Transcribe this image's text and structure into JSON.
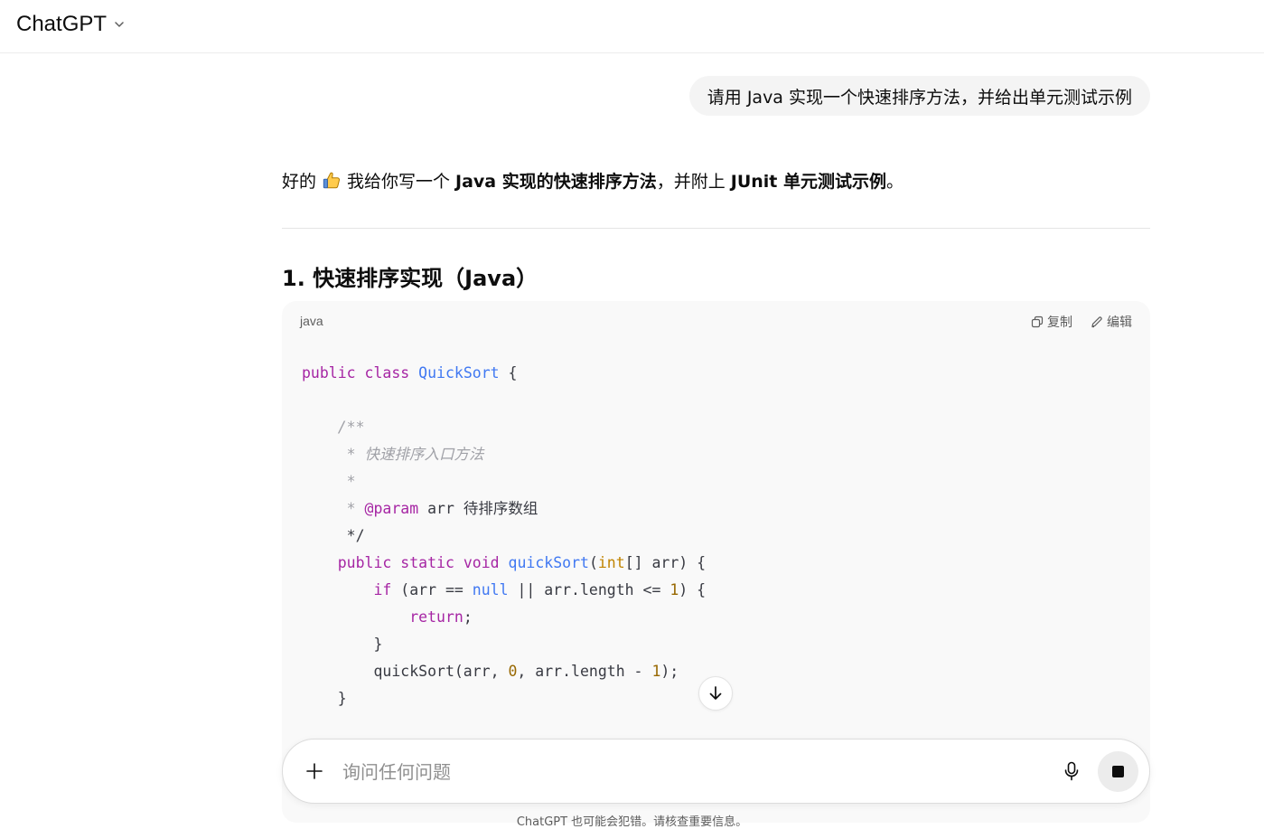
{
  "header": {
    "model_name": "ChatGPT"
  },
  "user_message": "请用 Java 实现一个快速排序方法，并给出单元测试示例",
  "assistant": {
    "intro": {
      "p1": "好的",
      "p2": "我给你写一个",
      "b1": "Java 实现的快速排序方法",
      "p3": "，并附上",
      "b2": "JUnit 单元测试示例",
      "p4": "。"
    },
    "section_heading": "1. 快速排序实现（Java）",
    "code_block": {
      "language": "java",
      "copy_label": "复制",
      "edit_label": "编辑",
      "lines": [
        "public class QuickSort {",
        "",
        "    /**",
        "     * 快速排序入口方法",
        "     *",
        "     * @param arr 待排序数组",
        "     */",
        "    public static void quickSort(int[] arr) {",
        "        if (arr == null || arr.length <= 1) {",
        "            return;",
        "        }",
        "        quickSort(arr, 0, arr.length - 1);",
        "    }"
      ]
    }
  },
  "composer": {
    "placeholder": "询问任何问题"
  },
  "disclaimer": "ChatGPT 也可能会犯错。请核查重要信息。",
  "icons": {
    "model_chevron": "chevron-down-icon",
    "emoji": "thumbs-up-emoji",
    "copy": "copy-icon",
    "edit": "edit-icon",
    "scroll": "arrow-down-icon",
    "plus": "plus-icon",
    "mic": "microphone-icon",
    "stop": "stop-icon"
  },
  "colors": {
    "background": "#ffffff",
    "user_bubble": "#f4f4f4",
    "code_background": "#f9f9f9",
    "keyword": "#a626a4",
    "function": "#4078f2",
    "comment": "#a0a1a7",
    "number": "#986801"
  }
}
